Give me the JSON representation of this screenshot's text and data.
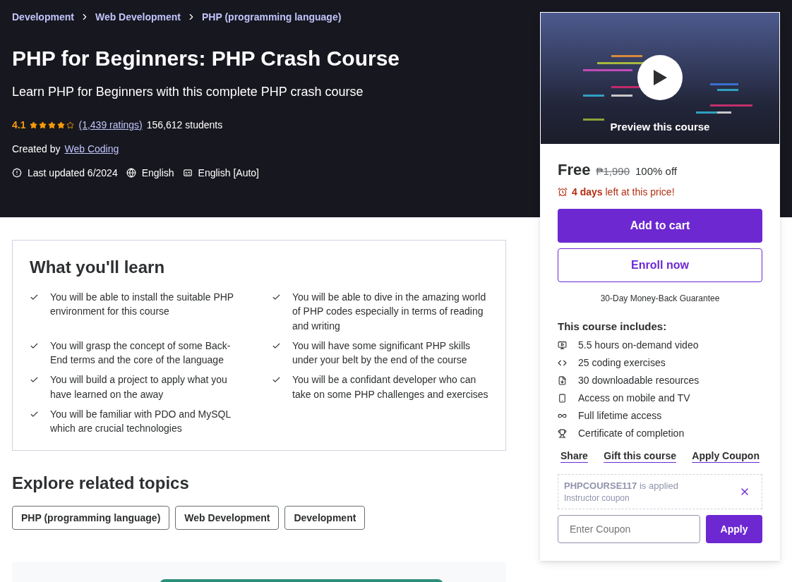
{
  "breadcrumbs": [
    "Development",
    "Web Development",
    "PHP (programming language)"
  ],
  "course": {
    "title": "PHP for Beginners: PHP Crash Course",
    "subtitle": "Learn PHP for Beginners with this complete PHP crash course",
    "rating": "4.1",
    "stars": 4,
    "ratings_link": "(1,439 ratings)",
    "students": "156,612 students",
    "created_by_label": "Created by",
    "instructor": "Web Coding",
    "last_updated": "Last updated 6/2024",
    "language": "English",
    "captions": "English [Auto]"
  },
  "learn": {
    "title": "What you'll learn",
    "items": [
      "You will be able to install the suitable PHP environment for this course",
      "You will be able to dive in the amazing world of PHP codes especially in terms of reading and writing",
      "You will grasp the concept of some Back-End terms and the core of the language",
      "You will have some significant PHP skills under your belt by the end of the course",
      "You will build a project to apply what you have learned on the away",
      "You will be a confidant developer who can take on some PHP challenges and exercises",
      "You will be familiar with PDO and MySQL which are crucial technologies"
    ]
  },
  "related": {
    "title": "Explore related topics",
    "topics": [
      "PHP (programming language)",
      "Web Development",
      "Development"
    ]
  },
  "sidebar": {
    "preview_label": "Preview this course",
    "price": "Free",
    "original_price": "₱1,990",
    "discount": "100% off",
    "timer": "**4 days** left at this price!",
    "add_to_cart": "Add to cart",
    "enroll": "Enroll now",
    "guarantee": "30-Day Money-Back Guarantee",
    "includes_title": "This course includes:",
    "includes": [
      "5.5 hours on-demand video",
      "25 coding exercises",
      "30 downloadable resources",
      "Access on mobile and TV",
      "Full lifetime access",
      "Certificate of completion"
    ],
    "links": [
      "Share",
      "Gift this course",
      "Apply Coupon"
    ],
    "coupon": {
      "applied": "**PHPCOURSE117** is applied",
      "note": "Instructor coupon"
    },
    "coupon_field": {
      "placeholder": "Enter Coupon"
    },
    "apply": "Apply"
  }
}
